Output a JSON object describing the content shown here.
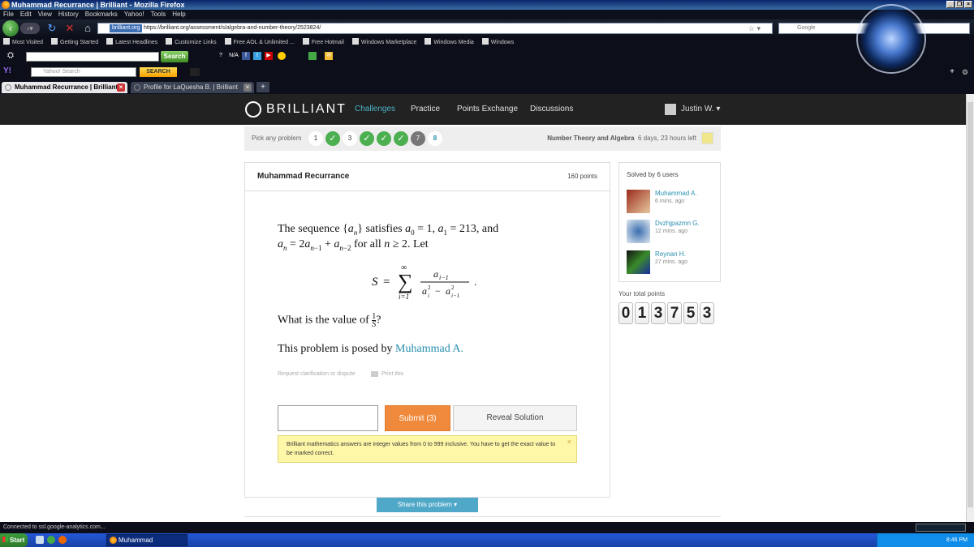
{
  "window": {
    "title": "Muhammad Recurrance | Brilliant - Mozilla Firefox"
  },
  "menu": [
    "File",
    "Edit",
    "View",
    "History",
    "Bookmarks",
    "Yahoo!",
    "Tools",
    "Help"
  ],
  "nav": {
    "url_site": "brilliant.org",
    "url": "https://brilliant.org/assessment/s/algebra-and-number-theory/2523824/",
    "search_placeholder": "Google"
  },
  "bookmarks": [
    "Most Visited",
    "Getting Started",
    "Latest Headlines",
    "Customize Links",
    "Free AOL & Unlimited ...",
    "Free Hotmail",
    "Windows Marketplace",
    "Windows Media",
    "Windows"
  ],
  "toolbar1": {
    "search_label": "Search",
    "na_label": "N/A"
  },
  "toolbar2": {
    "yahoo_logo": "Y!",
    "yahoo_placeholder": "Yahoo! Search",
    "search_label": "SEARCH"
  },
  "tabs": [
    {
      "label": "Muhammad Recurrance | Brilliant"
    },
    {
      "label": "Profile for LaQuesha B. | Brilliant"
    }
  ],
  "site": {
    "brand": "BRILLIANT",
    "nav": [
      "Challenges",
      "Practice",
      "Points Exchange",
      "Discussions"
    ],
    "user": "Justin W."
  },
  "problem_bar": {
    "label": "Pick any problem",
    "items": [
      "1",
      "✓",
      "3",
      "✓",
      "✓",
      "✓",
      "7",
      "8"
    ],
    "topic": "Number Theory and Algebra",
    "time_left": "6 days, 23 hours left"
  },
  "problem": {
    "title": "Muhammad Recurrance",
    "points": "160 points",
    "question": "What is the value of",
    "posed_prefix": "This problem is posed by",
    "posed_author": "Muhammad A.",
    "request": "Request clarification or dispute",
    "print": "Print this",
    "submit": "Submit (3)",
    "reveal": "Reveal Solution",
    "notice": "Brilliant mathematics answers are integer values from 0 to 999 inclusive. You have to get the exact value to be marked correct.",
    "share": "Share this problem"
  },
  "solved": {
    "title": "Solved by 6 users",
    "users": [
      {
        "name": "Muhammad A.",
        "time": "6 mins. ago"
      },
      {
        "name": "Dvzhjpazmn G.",
        "time": "12 mins. ago"
      },
      {
        "name": "Reynan H.",
        "time": "27 mins. ago"
      }
    ]
  },
  "total_points": {
    "label": "Your total points",
    "digits": [
      "0",
      "1",
      "3",
      "7",
      "5",
      "3"
    ]
  },
  "status": "Connected to ssl.google-analytics.com...",
  "taskbar": {
    "start": "Start",
    "window": "Muhammad Recurran...",
    "clock": "8:46 PM"
  }
}
